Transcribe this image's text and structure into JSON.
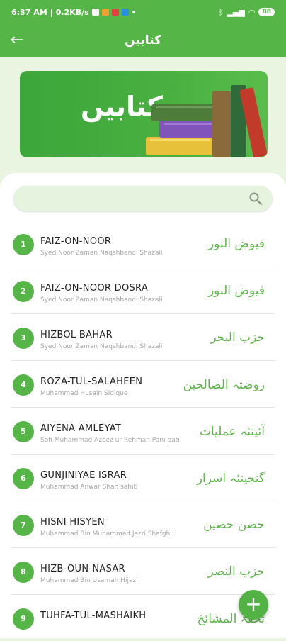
{
  "status": {
    "time": "6:37 AM",
    "speed": "0.2KB/s",
    "battery": "88"
  },
  "appbar": {
    "title": "کتابیں"
  },
  "banner": {
    "title": "کتابیں"
  },
  "search": {
    "placeholder": ""
  },
  "books": [
    {
      "num": "1",
      "title_en": "FAIZ-ON-NOOR",
      "author": "Syed Noor Zaman Naqshbandi Shazali",
      "title_ur": "فیوض النور"
    },
    {
      "num": "2",
      "title_en": "FAIZ-ON-NOOR DOSRA",
      "author": "Syed Noor Zaman Naqshbandi Shazali",
      "title_ur": "فیوض النور"
    },
    {
      "num": "3",
      "title_en": "HIZBOL BAHAR",
      "author": "Syed Noor Zaman Naqshbandi Shazali",
      "title_ur": "حزب البحر"
    },
    {
      "num": "4",
      "title_en": "ROZA-TUL-SALAHEEN",
      "author": "Muhammad Husain Sidique",
      "title_ur": "روضتہ الصالحین"
    },
    {
      "num": "5",
      "title_en": "AIYENA AMLEYAT",
      "author": "Sofi Muhammad Azeez ur Rehman Pani pati",
      "title_ur": "آئینئہ عملیات"
    },
    {
      "num": "6",
      "title_en": "GUNJINIYAE ISRAR",
      "author": "Muhammad Anwar Shah sahib",
      "title_ur": "گنجینئہ اسرار"
    },
    {
      "num": "7",
      "title_en": "HISNI HISYEN",
      "author": "Muhammad Bin Muhammad Jazri Shafghi",
      "title_ur": "حصن حصین"
    },
    {
      "num": "8",
      "title_en": "HIZB-OUN-NASAR",
      "author": "Muhammad Bin Usamah Hijazi",
      "title_ur": "حزب النصر"
    },
    {
      "num": "9",
      "title_en": "TUHFA-TUL-MASHAIKH",
      "author": "",
      "title_ur": "تحفۃ المشائخ"
    }
  ],
  "fab": {
    "label": "+"
  },
  "colors": {
    "primary": "#56b547",
    "accent_text": "#5fb54c"
  }
}
